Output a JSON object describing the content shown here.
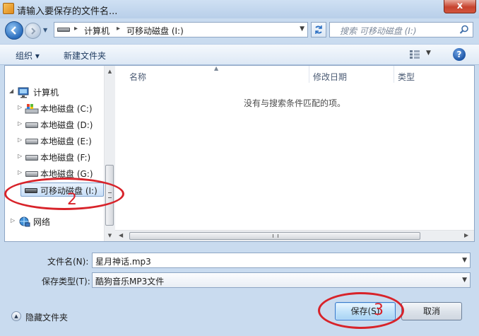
{
  "window": {
    "title": "请输入要保存的文件名...",
    "close_label": "x"
  },
  "navbar": {
    "breadcrumbs": [
      "计算机",
      "可移动磁盘 (I:)"
    ],
    "search_placeholder": "搜索 可移动磁盘 (I:)"
  },
  "toolbar": {
    "organize_label": "组织 ▾",
    "new_folder_label": "新建文件夹"
  },
  "nav_pane": {
    "items": [
      {
        "label": "计算机",
        "type": "computer"
      },
      {
        "label": "本地磁盘 (C:)",
        "type": "system-drive"
      },
      {
        "label": "本地磁盘 (D:)",
        "type": "drive"
      },
      {
        "label": "本地磁盘 (E:)",
        "type": "drive"
      },
      {
        "label": "本地磁盘 (F:)",
        "type": "drive"
      },
      {
        "label": "本地磁盘 (G:)",
        "type": "drive"
      },
      {
        "label": "可移动磁盘 (I:)",
        "type": "usb",
        "selected": true
      },
      {
        "label": "网络",
        "type": "network"
      }
    ]
  },
  "file_pane": {
    "columns": [
      "名称",
      "修改日期",
      "类型"
    ],
    "empty_message": "没有与搜索条件匹配的项。"
  },
  "form": {
    "filename_label": "文件名(N):",
    "filename_value": "星月神话.mp3",
    "filetype_label": "保存类型(T):",
    "filetype_value": "酷狗音乐MP3文件"
  },
  "footer": {
    "hide_folders_label": "隐藏文件夹",
    "save_label": "保存(S)",
    "cancel_label": "取消"
  },
  "annotations": {
    "step2": "2",
    "step3": "3"
  },
  "colors": {
    "annotation": "#d8232a",
    "accent": "#2a6dbd"
  }
}
